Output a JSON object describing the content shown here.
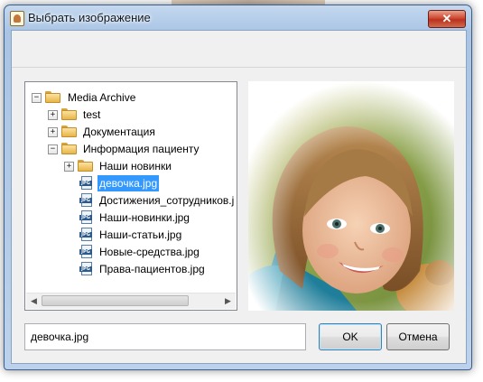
{
  "window": {
    "title": "Выбрать изображение",
    "close_glyph": "✕"
  },
  "tree": {
    "expander_collapsed": "+",
    "expander_expanded": "−",
    "root": "Media Archive",
    "items": [
      {
        "label": "test",
        "type": "folder"
      },
      {
        "label": "Документация",
        "type": "folder"
      },
      {
        "label": "Информация пациенту",
        "type": "folder"
      },
      {
        "label": "Наши новинки",
        "type": "folder"
      },
      {
        "label": "девочка.jpg",
        "type": "file",
        "selected": true
      },
      {
        "label": "Достижения_сотрудников.jpg",
        "type": "file"
      },
      {
        "label": "Наши-новинки.jpg",
        "type": "file"
      },
      {
        "label": "Наши-статьи.jpg",
        "type": "file"
      },
      {
        "label": "Новые-средства.jpg",
        "type": "file"
      },
      {
        "label": "Права-пациентов.jpg",
        "type": "file"
      }
    ],
    "file_icon_text": "JPG",
    "scroll_left": "◀",
    "scroll_right": "▶"
  },
  "filename_field": {
    "value": "девочка.jpg"
  },
  "buttons": {
    "ok": "OK",
    "cancel": "Отмена"
  },
  "colors": {
    "selection": "#3399ff",
    "title_close": "#c8412a"
  }
}
